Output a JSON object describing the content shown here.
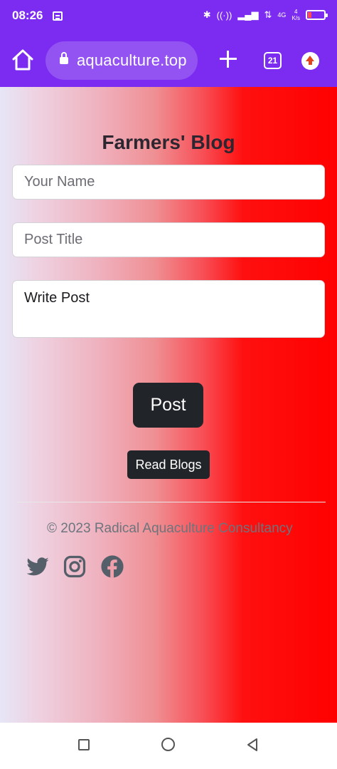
{
  "status_bar": {
    "time": "08:26",
    "net_speed_value": "4",
    "net_speed_unit": "K/s",
    "network": "4G"
  },
  "browser": {
    "url": "aquaculture.top",
    "tab_count": "21"
  },
  "page": {
    "title": "Farmers' Blog",
    "name_placeholder": "Your Name",
    "post_title_placeholder": "Post Title",
    "post_placeholder": "Write Post",
    "post_button": "Post",
    "read_blogs_button": "Read Blogs",
    "copyright": "© 2023 Radical Aquaculture Consultancy"
  },
  "colors": {
    "browser_chrome": "#7c2cf0",
    "button_dark": "#212529",
    "gradient_end": "#ff0000"
  }
}
